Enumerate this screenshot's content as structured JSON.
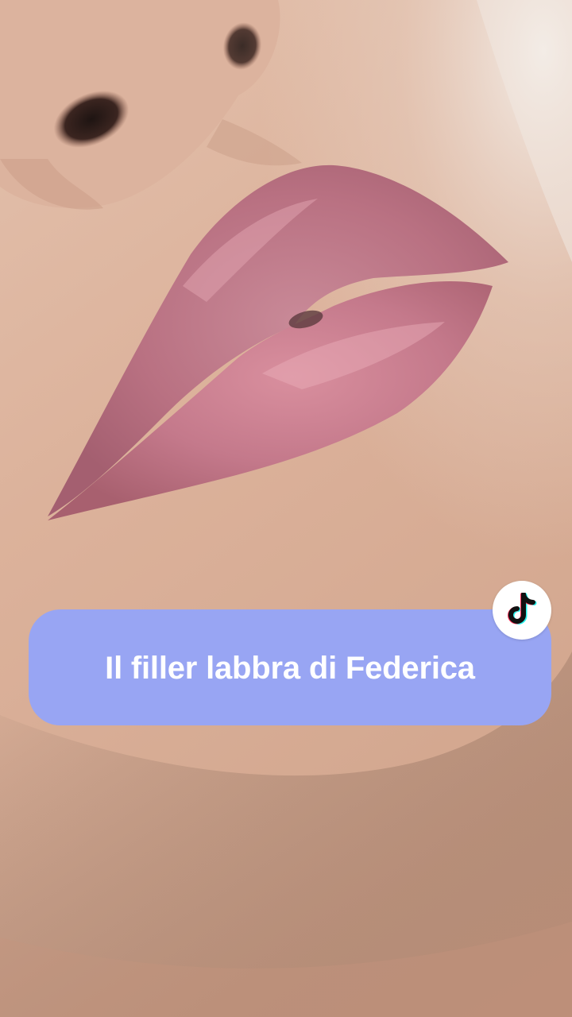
{
  "caption": {
    "text": "Il filler labbra di Federica",
    "background_color": "#98a5f3",
    "text_color": "#ffffff"
  },
  "badge": {
    "icon": "tiktok-logo-icon"
  },
  "photo": {
    "icon": "lips-closeup-photo"
  }
}
